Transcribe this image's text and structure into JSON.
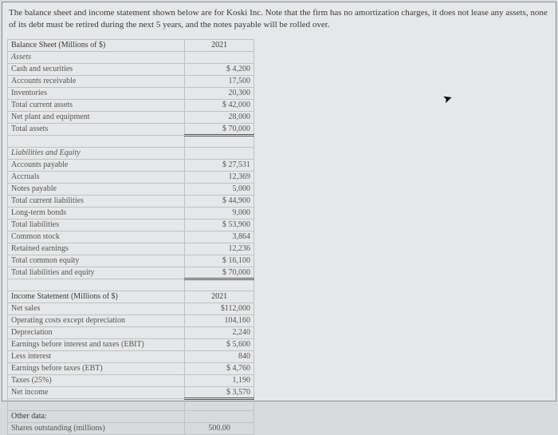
{
  "intro": "The balance sheet and income statement shown below are for Koski Inc. Note that the firm has no amortization charges, it does not lease any assets, none of its debt must be retired during the next 5 years, and the notes payable will be rolled over.",
  "bs": {
    "title": "Balance Sheet (Millions of $)",
    "year": "2021",
    "assets_header": "Assets",
    "rows": {
      "cash": {
        "l": "Cash and securities",
        "v": "$    4,200"
      },
      "ar": {
        "l": "Accounts receivable",
        "v": "17,500"
      },
      "inv": {
        "l": "Inventories",
        "v": "20,300"
      },
      "tca": {
        "l": "Total current assets",
        "v": "$  42,000"
      },
      "nppe": {
        "l": "Net plant and equipment",
        "v": "28,000"
      },
      "ta": {
        "l": "Total assets",
        "v": "$  70,000"
      }
    },
    "liab_header": "Liabilities and Equity",
    "lrows": {
      "ap": {
        "l": "Accounts payable",
        "v": "$  27,531"
      },
      "acc": {
        "l": "Accruals",
        "v": "12,369"
      },
      "np": {
        "l": "Notes payable",
        "v": "5,000"
      },
      "tcl": {
        "l": "Total current liabilities",
        "v": "$  44,900"
      },
      "ltb": {
        "l": "Long-term bonds",
        "v": "9,000"
      },
      "tl": {
        "l": "Total liabilities",
        "v": "$  53,900"
      },
      "cs": {
        "l": "Common stock",
        "v": "3,864"
      },
      "re": {
        "l": "Retained earnings",
        "v": "12,236"
      },
      "tce": {
        "l": "Total common equity",
        "v": "$  16,100"
      },
      "tle": {
        "l": "Total liabilities and equity",
        "v": "$  70,000"
      }
    }
  },
  "is": {
    "title": "Income Statement (Millions of $)",
    "year": "2021",
    "rows": {
      "ns": {
        "l": "Net sales",
        "v": "$112,000"
      },
      "oc": {
        "l": "Operating costs except depreciation",
        "v": "104,160"
      },
      "dep": {
        "l": "Depreciation",
        "v": "2,240"
      },
      "ebit": {
        "l": "Earnings before interest and taxes (EBIT)",
        "v": "$    5,600"
      },
      "int": {
        "l": "Less interest",
        "v": "840"
      },
      "ebt": {
        "l": "Earnings before taxes (EBT)",
        "v": "$    4,760"
      },
      "tax": {
        "l": "Taxes (25%)",
        "v": "1,190"
      },
      "ni": {
        "l": "Net income",
        "v": "$    3,570"
      }
    }
  },
  "other": {
    "title": "Other data:",
    "shares": {
      "l": "Shares outstanding (millions)",
      "v": "500.00"
    }
  }
}
